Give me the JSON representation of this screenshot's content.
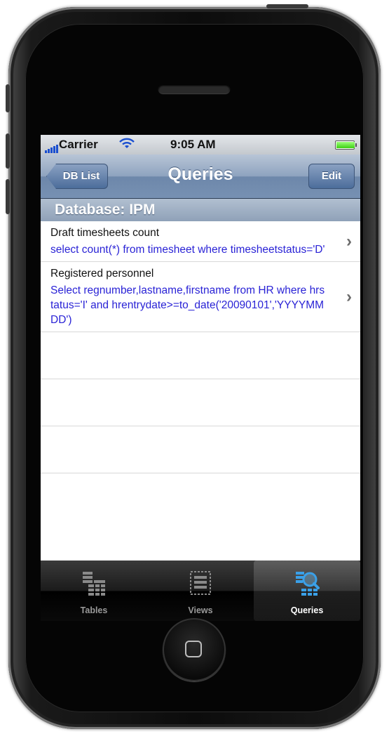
{
  "status_bar": {
    "carrier": "Carrier",
    "time": "9:05 AM"
  },
  "nav": {
    "back_label": "DB List",
    "title": "Queries",
    "edit_label": "Edit"
  },
  "section_header": "Database: IPM",
  "queries": [
    {
      "name": "Draft timesheets count",
      "sql": "select count(*) from timesheet where timesheetstatus='D'"
    },
    {
      "name": "Registered personnel",
      "sql": "Select regnumber,lastname,firstname from HR where hrstatus='I' and hrentrydate>=to_date('20090101','YYYYMMDD')"
    }
  ],
  "tabs": [
    {
      "label": "Tables",
      "icon": "tables-icon"
    },
    {
      "label": "Views",
      "icon": "views-icon"
    },
    {
      "label": "Queries",
      "icon": "queries-icon",
      "selected": true
    }
  ],
  "colors": {
    "sql_text": "#2a23d6",
    "nav_bar": "#7791b3",
    "selected_tab": "#ffffff"
  }
}
